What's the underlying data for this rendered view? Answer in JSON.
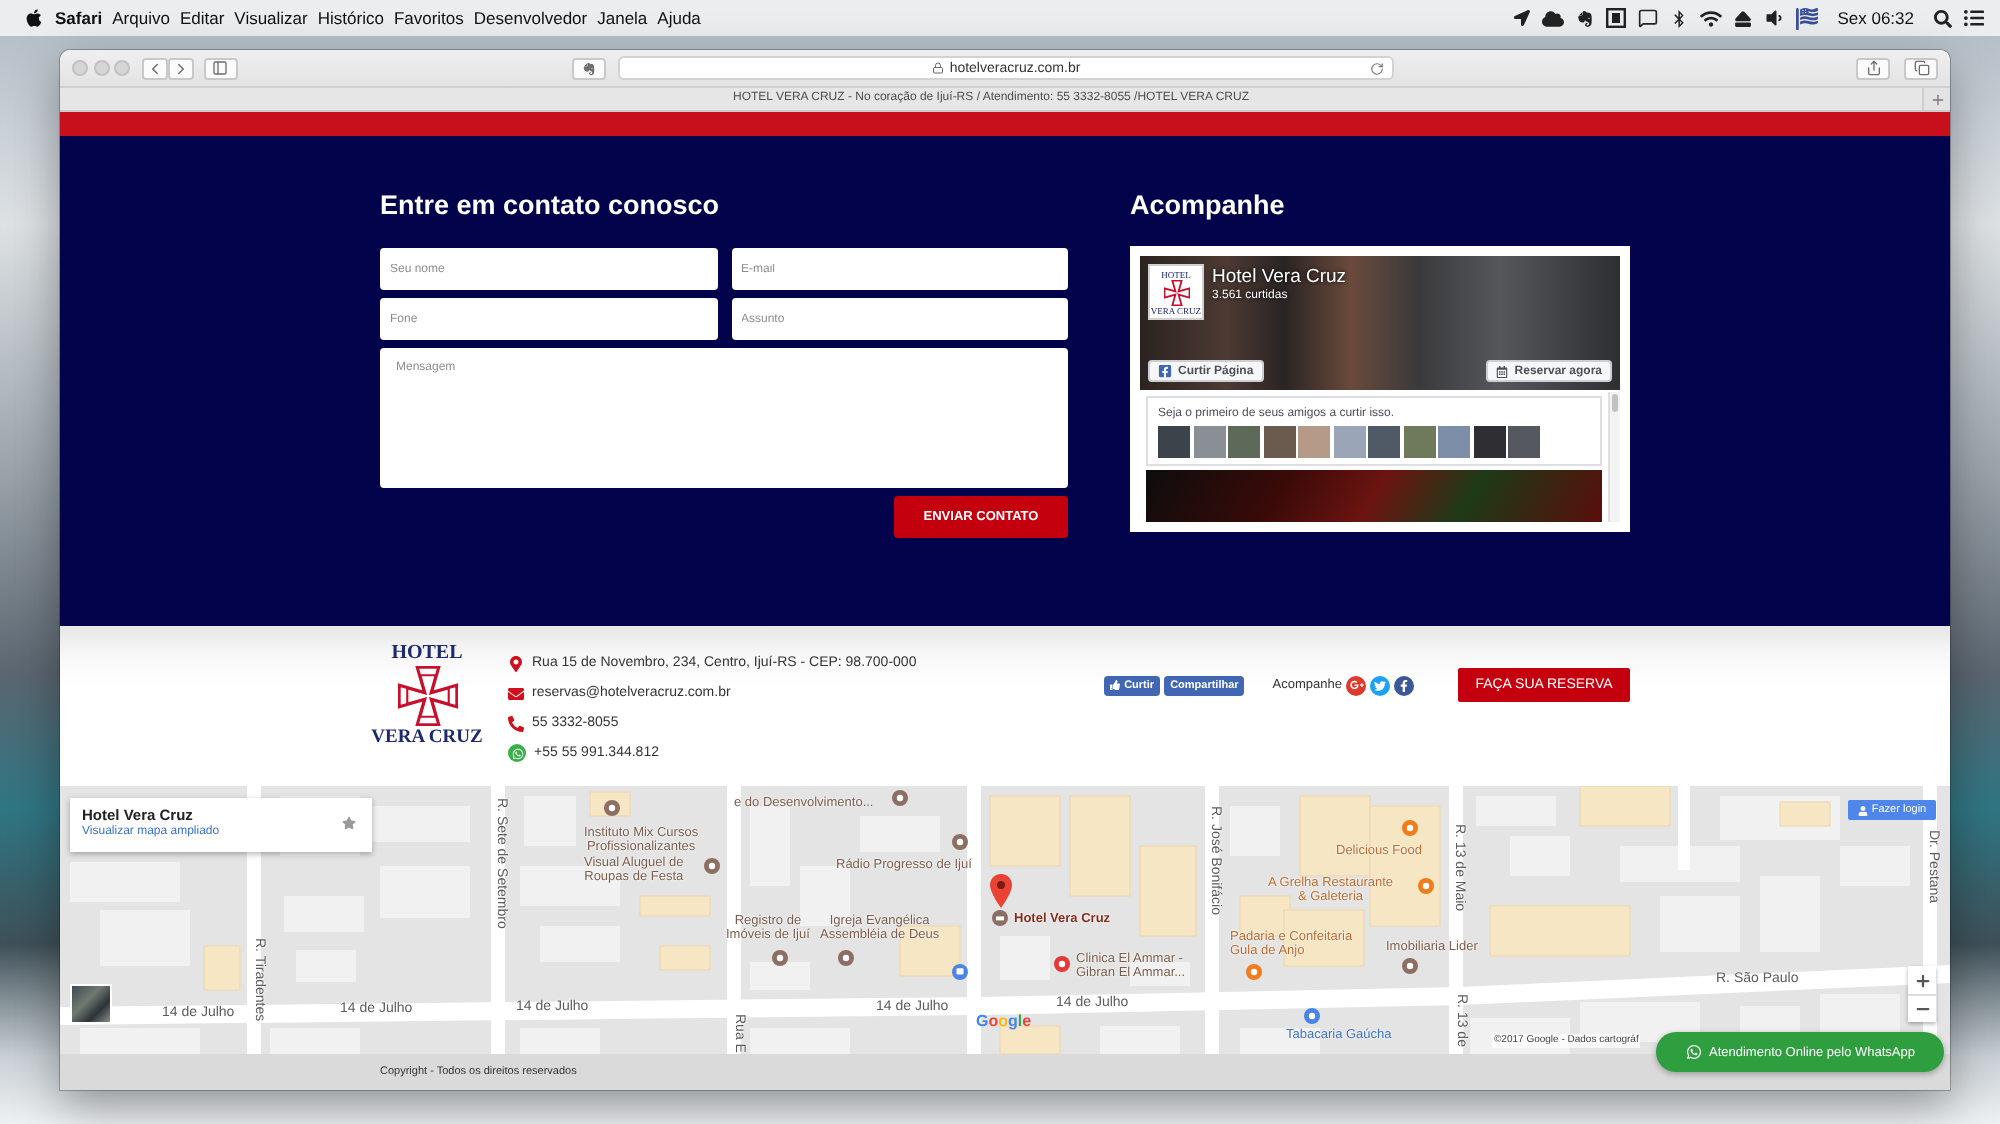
{
  "menu_bar": {
    "app": "Safari",
    "menus": [
      "Arquivo",
      "Editar",
      "Visualizar",
      "Histórico",
      "Favoritos",
      "Desenvolvedor",
      "Janela",
      "Ajuda"
    ],
    "clock": "Sex 06:32"
  },
  "browser": {
    "url": "hotelveracruz.com.br",
    "tab_title": "HOTEL VERA CRUZ - No coração de Ijuí-RS / Atendimento: 55 3332-8055 /HOTEL VERA CRUZ"
  },
  "contact": {
    "heading": "Entre em contato conosco",
    "fields": [
      {
        "kind": "input",
        "placeholder": "Seu nome"
      },
      {
        "kind": "input",
        "placeholder": "E-mail"
      },
      {
        "kind": "input",
        "placeholder": "Fone"
      },
      {
        "kind": "input",
        "placeholder": "Assunto"
      },
      {
        "kind": "textarea",
        "placeholder": "Mensagem"
      }
    ],
    "submit": "ENVIAR CONTATO"
  },
  "social_feed": {
    "heading": "Acompanhe",
    "page_logo": {
      "top": "HOTEL",
      "bottom": "VERA CRUZ"
    },
    "page_name": "Hotel Vera Cruz",
    "likes": "3.561 curtidas",
    "like_button": "Curtir Página",
    "action_button": "Reservar agora",
    "friends_prompt": "Seja o primeiro de seus amigos a curtir isso."
  },
  "footer": {
    "logo": {
      "top": "HOTEL",
      "bottom": "VERA CRUZ"
    },
    "contacts": [
      {
        "kind": "address",
        "text": "Rua 15 de Novembro, 234, Centro, Ijuí-RS - CEP: 98.700-000"
      },
      {
        "kind": "email",
        "text": "reservas@hotelveracruz.com.br"
      },
      {
        "kind": "phone",
        "text": "55 3332-8055"
      },
      {
        "kind": "whatsapp",
        "text": "+55 55 991.344.812"
      }
    ],
    "like_button": "Curtir",
    "share_button": "Compartilhar",
    "follow_label": "Acompanhe",
    "reserve_button": "FAÇA SUA RESERVA"
  },
  "map": {
    "place_card": {
      "title": "Hotel Vera Cruz",
      "link": "Visualizar mapa ampliado"
    },
    "login_button": "Fazer login",
    "streets": [
      {
        "name": "R. Sete de Setembro",
        "kind": "vertical"
      },
      {
        "name": "R. Tiradentes",
        "kind": "vertical"
      },
      {
        "name": "14 de Julho",
        "kind": "horizontal"
      },
      {
        "name": "14 de Julho",
        "kind": "horizontal"
      },
      {
        "name": "14 de Julho",
        "kind": "horizontal"
      },
      {
        "name": "Rua E",
        "kind": "vertical"
      },
      {
        "name": "14 de Julho",
        "kind": "horizontal"
      },
      {
        "name": "14 de Julho",
        "kind": "horizontal"
      },
      {
        "name": "R. José Bonifácio",
        "kind": "vertical"
      },
      {
        "name": "R. 13 de Maio",
        "kind": "vertical"
      },
      {
        "name": "R. 13 de",
        "kind": "vertical"
      },
      {
        "name": "R. São Paulo",
        "kind": "horizontal"
      },
      {
        "name": "Dr. Pestana",
        "kind": "vertical"
      }
    ],
    "places": [
      {
        "lines": [
          "e do Desenvolvimento..."
        ],
        "kind": "place"
      },
      {
        "lines": [
          "Instituto Mix Cursos",
          "Profissionalizantes"
        ],
        "kind": "place"
      },
      {
        "lines": [
          "Visual Aluguel de",
          "Roupas de Festa"
        ],
        "kind": "place"
      },
      {
        "lines": [
          "Rádio Progresso de Ijuí"
        ],
        "kind": "place"
      },
      {
        "lines": [
          "Registro de",
          "Imóveis de Ijuí"
        ],
        "kind": "place"
      },
      {
        "lines": [
          "Igreja Evangélica",
          "Assembléia de Deus"
        ],
        "kind": "place"
      },
      {
        "lines": [
          "Delicious Food"
        ],
        "kind": "restaurant"
      },
      {
        "lines": [
          "A Grelha Restaurante",
          "& Galeteria"
        ],
        "kind": "restaurant"
      },
      {
        "lines": [
          "Padaria e Confeitaria",
          "Gula de Anjo"
        ],
        "kind": "restaurant"
      },
      {
        "lines": [
          "Imobiliaria Lider"
        ],
        "kind": "place"
      },
      {
        "lines": [
          "Clinica El Ammar -",
          "Gibran El Ammar..."
        ],
        "kind": "health"
      },
      {
        "lines": [
          "Tabacaria Gaúcha"
        ],
        "kind": "shop"
      }
    ],
    "hotel_pin": "Hotel Vera Cruz",
    "logo": "Google",
    "attribution": "©2017 Google - Dados cartográf"
  },
  "copyright": "Copyright - Todos os direitos reservados",
  "chat_button": "Atendimento Online pelo WhatsApp"
}
